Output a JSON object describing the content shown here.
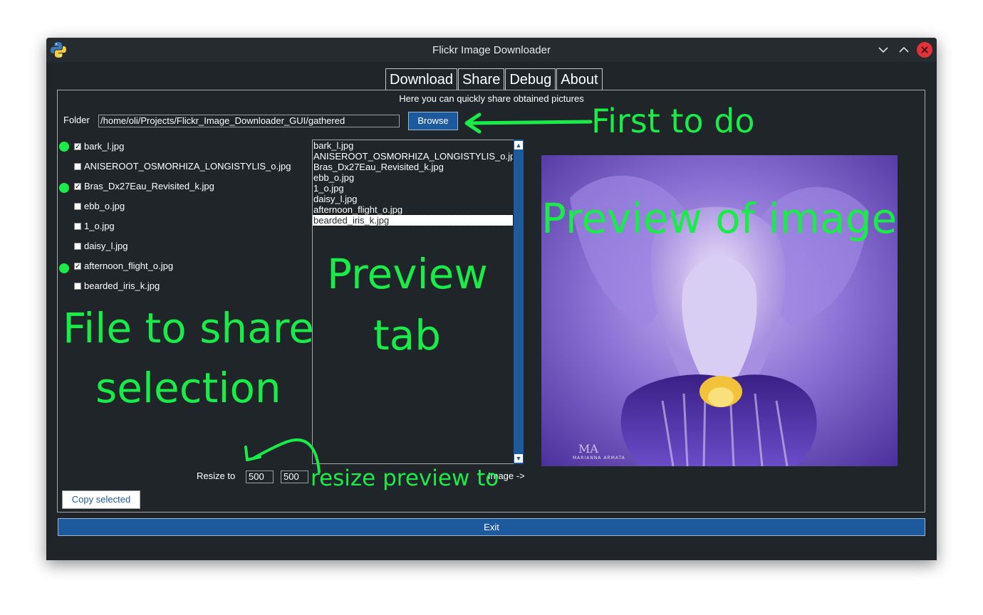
{
  "window": {
    "title": "Flickr Image Downloader"
  },
  "titlebar_buttons": {
    "minimize": "⌄",
    "maximize": "⌃",
    "close": "×"
  },
  "tabs": [
    {
      "label": "Download",
      "active": false
    },
    {
      "label": "Share",
      "active": true
    },
    {
      "label": "Debug",
      "active": false
    },
    {
      "label": "About",
      "active": false
    }
  ],
  "share": {
    "subtitle": "Here you can quickly share obtained pictures",
    "folder_label": "Folder",
    "folder_value": "/home/oli/Projects/Flickr_Image_Downloader_GUI/gathered",
    "browse_label": "Browse",
    "files": [
      {
        "name": "bark_l.jpg",
        "checked": true
      },
      {
        "name": "ANISEROOT_OSMORHIZA_LONGISTYLIS_o.jpg",
        "checked": false
      },
      {
        "name": "Bras_Dx27Eau_Revisited_k.jpg",
        "checked": true
      },
      {
        "name": "ebb_o.jpg",
        "checked": false
      },
      {
        "name": "1_o.jpg",
        "checked": false
      },
      {
        "name": "daisy_l.jpg",
        "checked": false
      },
      {
        "name": "afternoon_flight_o.jpg",
        "checked": true
      },
      {
        "name": "bearded_iris_k.jpg",
        "checked": false
      }
    ],
    "preview_list": [
      "bark_l.jpg",
      "ANISEROOT_OSMORHIZA_LONGISTYLIS_o.jpg",
      "Bras_Dx27Eau_Revisited_k.jpg",
      "ebb_o.jpg",
      "1_o.jpg",
      "daisy_l.jpg",
      "afternoon_flight_o.jpg",
      "bearded_iris_k.jpg"
    ],
    "preview_selected": "bearded_iris_k.jpg",
    "resize_label": "Resize to",
    "resize_width": "500",
    "resize_height": "500",
    "image_arrow_label": "Image ->",
    "copy_label": "Copy selected",
    "image_watermark": "MARIANNA ARMATA",
    "image_watermark_monogram": "MA"
  },
  "exit_label": "Exit",
  "annotations": {
    "first": "First to do",
    "preview_image": "Preview of image",
    "preview_tab_line1": "Preview",
    "preview_tab_line2": "tab",
    "file_share_line1": "File to share",
    "file_share_line2": "selection",
    "resize_preview": "resize preview to"
  },
  "colors": {
    "background": "#1f2529",
    "accent": "#1d5a9d",
    "annotation": "#19ec48",
    "close": "#e0323a"
  }
}
